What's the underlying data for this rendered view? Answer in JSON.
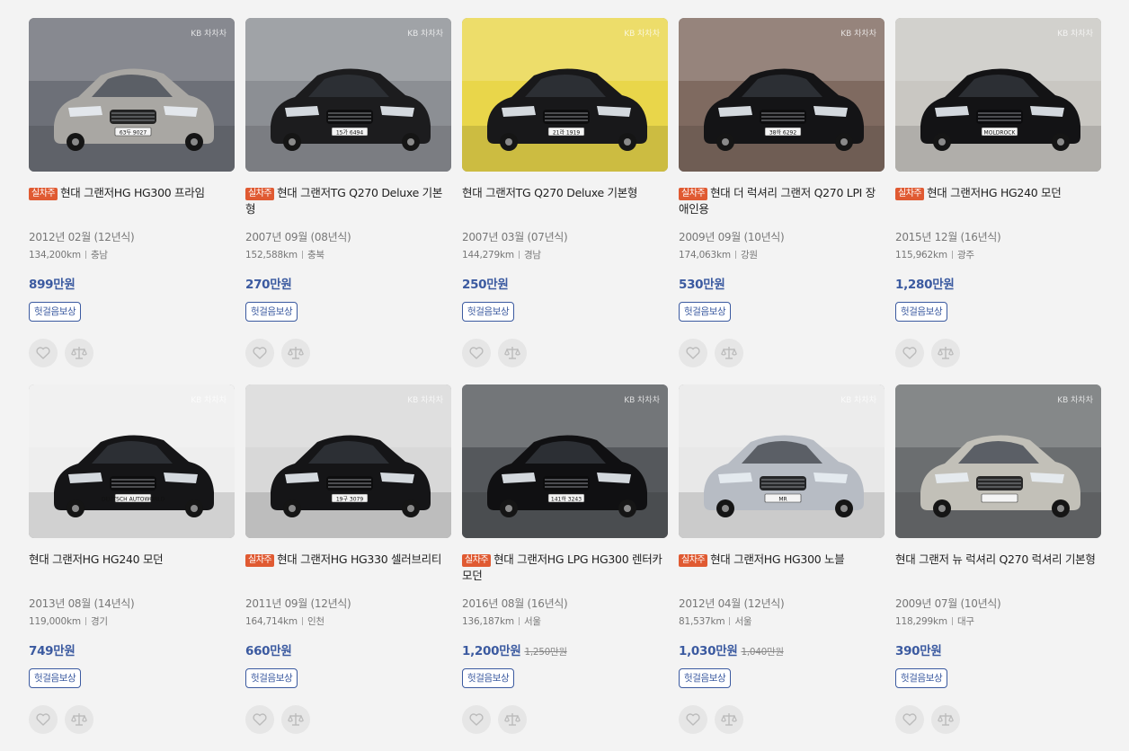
{
  "labels": {
    "badge": "실차주",
    "tag": "헛걸음보상",
    "watermark": "KB 차차차"
  },
  "colors": {
    "accent": "#3b5aa0",
    "badge": "#e05a32"
  },
  "listings": [
    {
      "badge": true,
      "title": "현대 그랜저HG HG300 프라임",
      "year": "2012년 02월 (12년식)",
      "km": "134,200km",
      "region": "충남",
      "price": "899만원",
      "old_price": "",
      "car_color": "#a9a7a3",
      "bg_color": "#6d7078",
      "plate": "63두 9027"
    },
    {
      "badge": true,
      "title": "현대 그랜저TG Q270 Deluxe 기본형",
      "year": "2007년 09월 (08년식)",
      "km": "152,588km",
      "region": "충북",
      "price": "270만원",
      "old_price": "",
      "car_color": "#1c1c1e",
      "bg_color": "#8c8f94",
      "plate": "15가 6494"
    },
    {
      "badge": false,
      "title": "현대 그랜저TG Q270 Deluxe 기본형",
      "year": "2007년 03월 (07년식)",
      "km": "144,279km",
      "region": "경남",
      "price": "250만원",
      "old_price": "",
      "car_color": "#18181a",
      "bg_color": "#e9d64a",
      "plate": "21라 1919"
    },
    {
      "badge": true,
      "title": "현대 더 럭셔리 그랜저 Q270 LPI 장애인용",
      "year": "2009년 09월 (10년식)",
      "km": "174,063km",
      "region": "강원",
      "price": "530만원",
      "old_price": "",
      "car_color": "#141416",
      "bg_color": "#7f6a60",
      "plate": "38하 6292"
    },
    {
      "badge": true,
      "title": "현대 그랜저HG HG240 모던",
      "year": "2015년 12월 (16년식)",
      "km": "115,962km",
      "region": "광주",
      "price": "1,280만원",
      "old_price": "",
      "car_color": "#131315",
      "bg_color": "#c9c7c2",
      "plate": "MOLDROCK"
    },
    {
      "badge": false,
      "title": "현대 그랜저HG HG240 모던",
      "year": "2013년 08월 (14년식)",
      "km": "119,000km",
      "region": "경기",
      "price": "749만원",
      "old_price": "",
      "car_color": "#151517",
      "bg_color": "#eeeeee",
      "plate": "DEUTSCH AUTOWORLD"
    },
    {
      "badge": true,
      "title": "현대 그랜저HG HG330 셀러브리티",
      "year": "2011년 09월 (12년식)",
      "km": "164,714km",
      "region": "인천",
      "price": "660만원",
      "old_price": "",
      "car_color": "#151517",
      "bg_color": "#d8d8d8",
      "plate": "19구 3079"
    },
    {
      "badge": true,
      "title": "현대 그랜저HG LPG HG300 렌터카 모던",
      "year": "2016년 08월 (16년식)",
      "km": "136,187km",
      "region": "서울",
      "price": "1,200만원",
      "old_price": "1,250만원",
      "car_color": "#101012",
      "bg_color": "#55585c",
      "plate": "141하 3243"
    },
    {
      "badge": true,
      "title": "현대 그랜저HG HG300 노블",
      "year": "2012년 04월 (12년식)",
      "km": "81,537km",
      "region": "서울",
      "price": "1,030만원",
      "old_price": "1,040만원",
      "car_color": "#b7bcc4",
      "bg_color": "#e8e8e8",
      "plate": "MR"
    },
    {
      "badge": false,
      "title": "현대 그랜저 뉴 럭셔리 Q270 럭셔리 기본형",
      "year": "2009년 07월 (10년식)",
      "km": "118,299km",
      "region": "대구",
      "price": "390만원",
      "old_price": "",
      "car_color": "#c2c0b8",
      "bg_color": "#6b6e70",
      "plate": ""
    }
  ]
}
